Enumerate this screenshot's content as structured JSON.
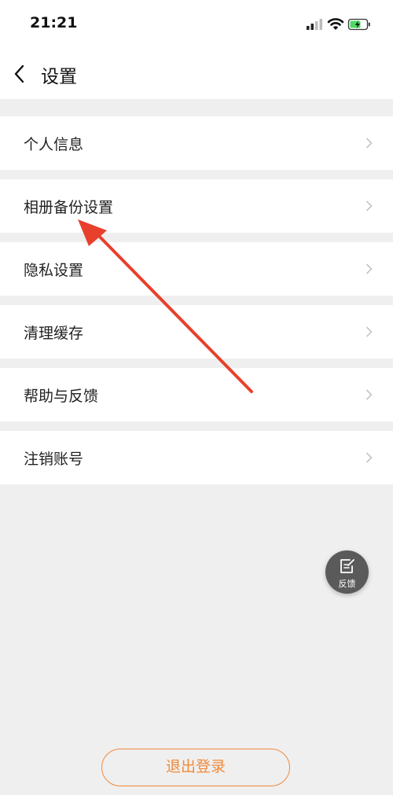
{
  "status_bar": {
    "time": "21:21",
    "icons": [
      "signal-icon",
      "wifi-icon",
      "battery-charging-icon"
    ]
  },
  "header": {
    "title": "设置",
    "back_icon": "chevron-left-icon"
  },
  "menu": {
    "items": [
      {
        "label": "个人信息"
      },
      {
        "label": "相册备份设置"
      },
      {
        "label": "隐私设置"
      },
      {
        "label": "清理缓存"
      },
      {
        "label": "帮助与反馈"
      },
      {
        "label": "注销账号"
      }
    ]
  },
  "feedback_fab": {
    "label": "反馈",
    "icon": "edit-note-icon"
  },
  "logout": {
    "label": "退出登录"
  },
  "colors": {
    "accent": "#f08a3c",
    "annotation_arrow": "#e8402c",
    "background": "#efefef"
  }
}
